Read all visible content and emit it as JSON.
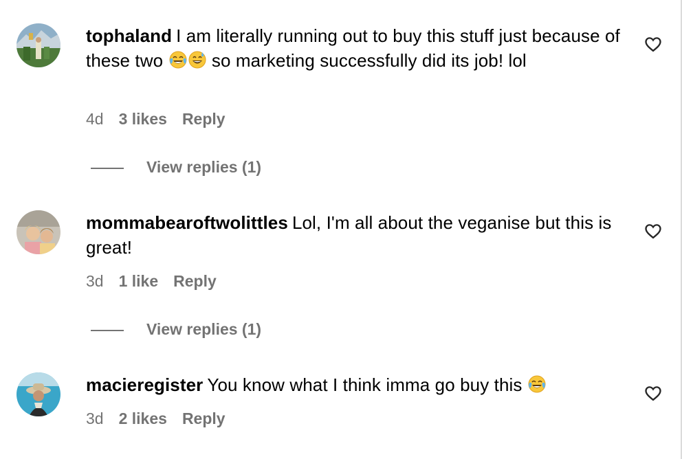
{
  "comments": [
    {
      "username": "tophaland",
      "text_before": "I am literally running out to buy this stuff just because of these two",
      "text_after": "so marketing successfully did its job! lol",
      "time": "4d",
      "likes": "3 likes",
      "reply": "Reply",
      "view_replies": "View replies (1)",
      "emojis": [
        "face-with-tears-of-joy",
        "grinning-face-with-sweat"
      ]
    },
    {
      "username": "mommabearoftwolittles",
      "text_before": "Lol, I'm all about the veganise but this is great!",
      "time": "3d",
      "likes": "1 like",
      "reply": "Reply",
      "view_replies": "View replies (1)"
    },
    {
      "username": "macieregister",
      "text_before": "You know what I think imma go buy this",
      "time": "3d",
      "likes": "2 likes",
      "reply": "Reply",
      "emojis": [
        "face-with-tears-of-joy"
      ]
    }
  ],
  "icons": {
    "like": "heart-outline-icon"
  },
  "colors": {
    "text": "#000000",
    "secondary": "#737373",
    "background": "#ffffff"
  }
}
